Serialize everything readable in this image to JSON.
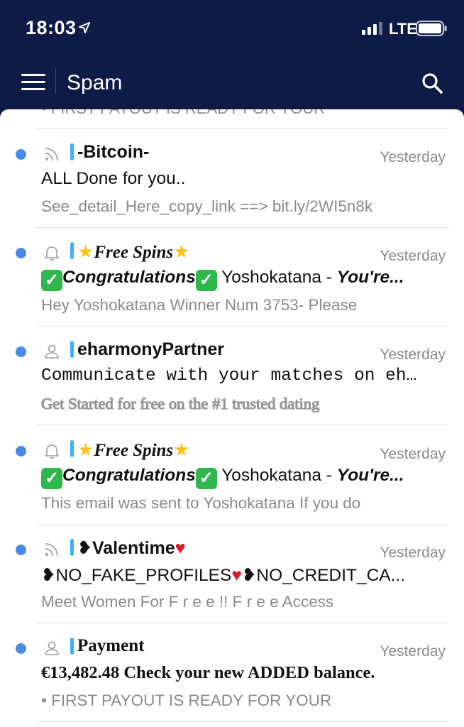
{
  "status_bar": {
    "time": "18:03",
    "network": "LTE"
  },
  "nav": {
    "title": "Spam"
  },
  "peek_text": "• FIRST PAYOUT IS READY FOR YOUR",
  "emails": [
    {
      "sender": "-Bitcoin-",
      "date": "Yesterday",
      "subject": "ALL Done for you..",
      "preview": "See_detail_Here_copy_link ==> bit.ly/2WI5n8k",
      "type_icon": "rss-icon"
    },
    {
      "sender": "Free Spins",
      "date": "Yesterday",
      "subject_a": "Congratulations",
      "subject_b": " Yoshokatana - ",
      "subject_c": "You're...",
      "preview": "Hey Yoshokatana Winner Num 3753- Please",
      "type_icon": "bell-icon"
    },
    {
      "sender": "eharmonyPartner",
      "date": "Yesterday",
      "subject": "Communicate with your matches on eharm...",
      "preview": "Get Started for free on the #1 trusted dating",
      "type_icon": "person-icon"
    },
    {
      "sender": "Free Spins",
      "date": "Yesterday",
      "subject_a": "Congratulations",
      "subject_b": " Yoshokatana - ",
      "subject_c": "You're...",
      "preview": "This email was sent to Yoshokatana If you do",
      "type_icon": "bell-icon"
    },
    {
      "sender": "Valentime",
      "date": "Yesterday",
      "subject_a": "NO_FAKE_PROFILES",
      "subject_b": "NO_CREDIT_CA...",
      "preview": "Meet Women For F r e e !! F r e e Access",
      "type_icon": "rss-icon"
    },
    {
      "sender": "Payment",
      "date": "Yesterday",
      "subject": "€13,482.48 Check your new ADDED balance.",
      "preview": "• FIRST PAYOUT IS READY FOR YOUR",
      "type_icon": "person-icon"
    }
  ],
  "colors": {
    "header_bg": "#0e1b47",
    "unread_dot": "#4a8ae6",
    "sender_bar": "#39b5f0"
  }
}
